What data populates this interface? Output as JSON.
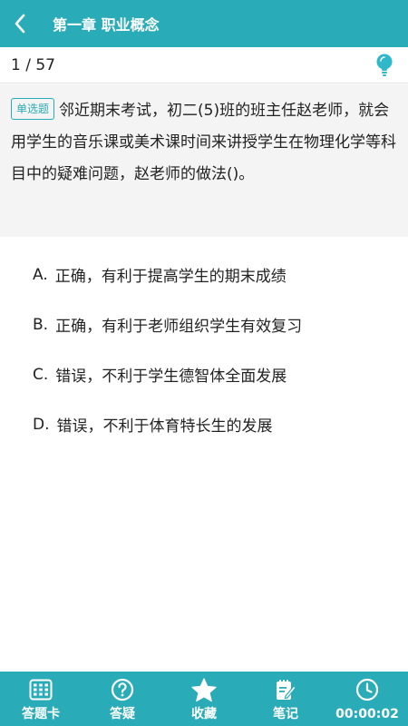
{
  "header": {
    "title": "第一章 职业概念",
    "back_icon": "chevron-left-icon"
  },
  "progress": {
    "text": "1 / 57",
    "current": 1,
    "total": 57,
    "hint_icon": "lightbulb-icon"
  },
  "question": {
    "type_label": "单选题",
    "text": "邻近期末考试，初二(5)班的班主任赵老师，就会用学生的音乐课或美术课时间来讲授学生在物理化学等科目中的疑难问题，赵老师的做法()。"
  },
  "options": [
    {
      "letter": "A.",
      "text": "正确，有利于提高学生的期末成绩"
    },
    {
      "letter": "B.",
      "text": "正确，有利于老师组织学生有效复习"
    },
    {
      "letter": "C.",
      "text": "错误，不利于学生德智体全面发展"
    },
    {
      "letter": "D.",
      "text": "错误，不利于体育特长生的发展"
    }
  ],
  "bottom_bar": {
    "items": [
      {
        "label": "答题卡",
        "icon": "grid-card-icon"
      },
      {
        "label": "答疑",
        "icon": "question-circle-icon"
      },
      {
        "label": "收藏",
        "icon": "star-icon"
      },
      {
        "label": "笔记",
        "icon": "note-edit-icon"
      },
      {
        "label": "00:00:02",
        "icon": "clock-icon"
      }
    ]
  },
  "colors": {
    "primary": "#2aacb8",
    "question_bg": "#f4f4f4",
    "hint_icon": "#2fb8c9"
  }
}
